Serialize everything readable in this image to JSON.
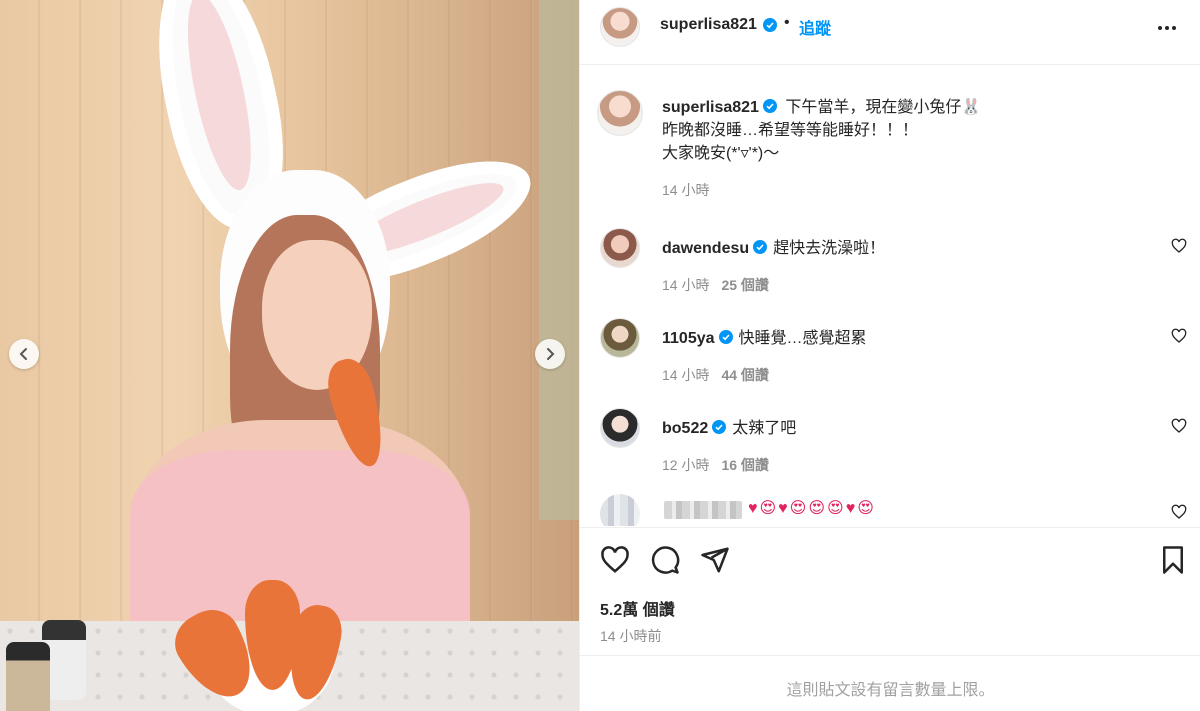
{
  "post": {
    "author": "superlisa821",
    "follow_label": "追蹤",
    "dot": "•",
    "caption": {
      "author": "superlisa821",
      "lines": [
        "下午當羊，現在變小兔仔🐰",
        "昨晚都沒睡…希望等等能睡好！！！",
        "大家晚安(*'▿'*)～"
      ],
      "time": "14 小時"
    },
    "comments": [
      {
        "user": "dawendesu",
        "text": "趕快去洗澡啦！",
        "time": "14 小時",
        "likes": "25 個讚",
        "verified": true
      },
      {
        "user": "1105ya",
        "text": "快睡覺…感覺超累",
        "time": "14 小時",
        "likes": "44 個讚",
        "verified": true
      },
      {
        "user": "bo522",
        "text": "太辣了吧",
        "time": "12 小時",
        "likes": "16 個讚",
        "verified": true
      },
      {
        "user": "",
        "text": "♥😍♥😍😍😍♥😍",
        "time": "",
        "likes": "",
        "verified": false
      }
    ],
    "likes_count": "5.2萬 個讚",
    "posted_ago": "14 小時前",
    "comment_limit_notice": "這則貼文設有留言數量上限。"
  },
  "colors": {
    "accent": "#0095f6",
    "verified": "#0095f6",
    "secondary_text": "#8e8e8e"
  },
  "icons": [
    "chevron-left-icon",
    "chevron-right-icon",
    "more-icon",
    "heart-icon",
    "comment-icon",
    "share-icon",
    "bookmark-icon",
    "verified-icon"
  ]
}
